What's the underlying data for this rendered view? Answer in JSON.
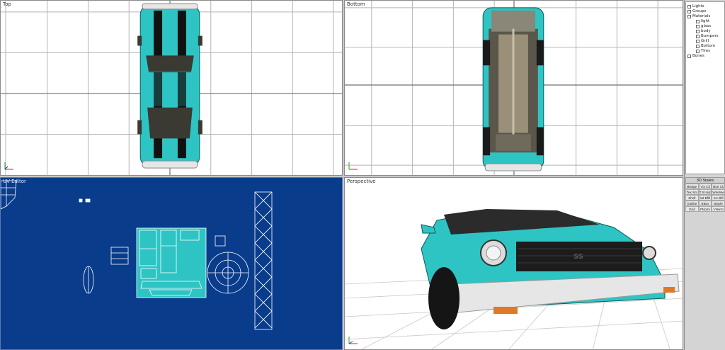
{
  "viewports": {
    "top": {
      "label": "Top"
    },
    "bottom": {
      "label": "Bottom"
    },
    "uv": {
      "label": "UV Editor"
    },
    "perspective": {
      "label": "Perspective"
    }
  },
  "tree": {
    "items": [
      {
        "label": "Lights",
        "level": 1
      },
      {
        "label": "Groups",
        "level": 1
      },
      {
        "label": "Materials",
        "level": 1
      },
      {
        "label": "light",
        "level": 2
      },
      {
        "label": "glass",
        "level": 2
      },
      {
        "label": "body",
        "level": 2
      },
      {
        "label": "Bumpers",
        "level": 2
      },
      {
        "label": "Grill",
        "level": 2
      },
      {
        "label": "Bottom",
        "level": 2
      },
      {
        "label": "Tires",
        "level": 2
      },
      {
        "label": "Bones",
        "level": 1
      }
    ]
  },
  "states": {
    "title": "3D States",
    "buttons": [
      "BEdge",
      "Vtx Cli",
      "Bne Cli",
      "Tex Sm",
      "T.Scratch",
      "Wireline",
      "Shell",
      "Sd Bfill",
      "Inc Bfil",
      "Outline",
      "BBox",
      "BSphr",
      "Grid",
      "FNorm",
      "VNorm"
    ]
  },
  "car": {
    "body_color": "#2ec4c4",
    "grille_badge": "SS"
  },
  "colors": {
    "uv_background": "#0a3c8c",
    "grid_line": "#b4b4b4"
  }
}
